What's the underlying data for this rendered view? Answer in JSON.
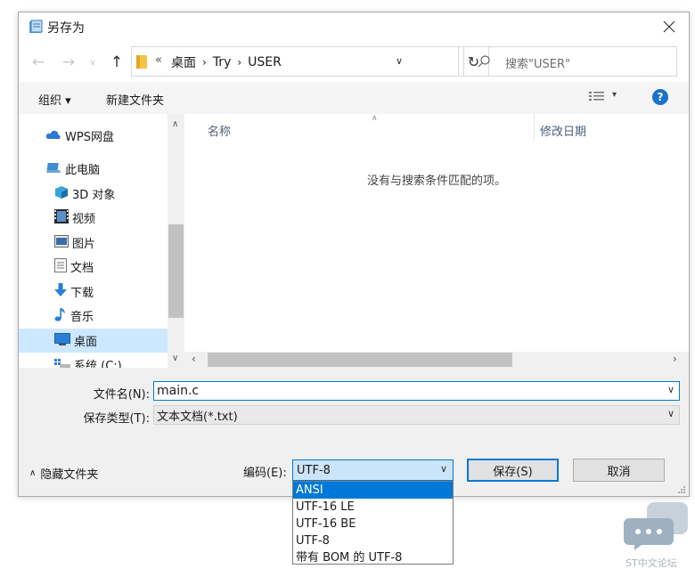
{
  "window": {
    "title": "另存为"
  },
  "address": {
    "overflow": "«",
    "path": [
      "桌面",
      "Try",
      "USER"
    ],
    "search_placeholder": "搜索\"USER\""
  },
  "toolbar": {
    "organize": "组织 ▾",
    "new_folder": "新建文件夹"
  },
  "sidebar": {
    "items": [
      {
        "label": "WPS网盘",
        "icon": "cloud-icon"
      },
      {
        "label": "此电脑",
        "icon": "computer-icon"
      },
      {
        "label": "3D 对象",
        "icon": "cube-icon"
      },
      {
        "label": "视频",
        "icon": "video-icon"
      },
      {
        "label": "图片",
        "icon": "picture-icon"
      },
      {
        "label": "文档",
        "icon": "document-icon"
      },
      {
        "label": "下载",
        "icon": "download-icon"
      },
      {
        "label": "音乐",
        "icon": "music-icon"
      },
      {
        "label": "桌面",
        "icon": "desktop-icon",
        "selected": true
      },
      {
        "label": "系统 (C:)",
        "icon": "drive-icon"
      }
    ]
  },
  "filelist": {
    "col_name": "名称",
    "col_date": "修改日期",
    "empty_message": "没有与搜索条件匹配的项。"
  },
  "form": {
    "filename_label": "文件名(N):",
    "filename_value": "main.c",
    "filetype_label": "保存类型(T):",
    "filetype_value": "文本文档(*.txt)",
    "hide_folders": "隐藏文件夹",
    "encoding_label": "编码(E):",
    "encoding_value": "UTF-8",
    "save": "保存(S)",
    "cancel": "取消"
  },
  "encoding_options": [
    "ANSI",
    "UTF-16 LE",
    "UTF-16 BE",
    "UTF-8",
    "带有 BOM 的 UTF-8"
  ],
  "encoding_highlighted": "ANSI",
  "watermark": {
    "text": "ST中文论坛"
  },
  "colors": {
    "selection": "#0078d7",
    "sidebar_selected": "#cce8ff",
    "help": "#1a73c8",
    "folder": "#f7c244"
  }
}
